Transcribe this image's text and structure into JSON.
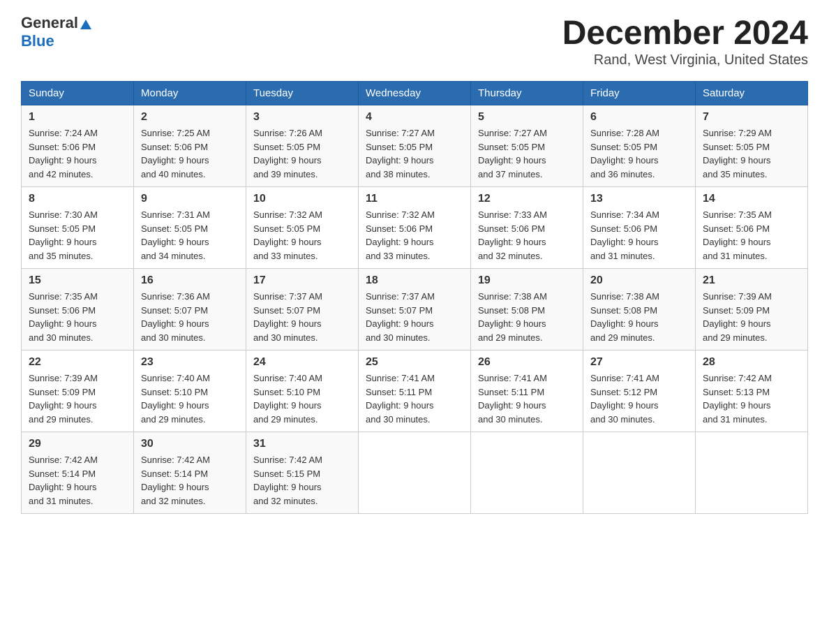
{
  "header": {
    "logo_general": "General",
    "logo_blue": "Blue",
    "month_title": "December 2024",
    "location": "Rand, West Virginia, United States"
  },
  "days_of_week": [
    "Sunday",
    "Monday",
    "Tuesday",
    "Wednesday",
    "Thursday",
    "Friday",
    "Saturday"
  ],
  "weeks": [
    [
      {
        "num": "1",
        "sunrise": "7:24 AM",
        "sunset": "5:06 PM",
        "daylight": "9 hours and 42 minutes."
      },
      {
        "num": "2",
        "sunrise": "7:25 AM",
        "sunset": "5:06 PM",
        "daylight": "9 hours and 40 minutes."
      },
      {
        "num": "3",
        "sunrise": "7:26 AM",
        "sunset": "5:05 PM",
        "daylight": "9 hours and 39 minutes."
      },
      {
        "num": "4",
        "sunrise": "7:27 AM",
        "sunset": "5:05 PM",
        "daylight": "9 hours and 38 minutes."
      },
      {
        "num": "5",
        "sunrise": "7:27 AM",
        "sunset": "5:05 PM",
        "daylight": "9 hours and 37 minutes."
      },
      {
        "num": "6",
        "sunrise": "7:28 AM",
        "sunset": "5:05 PM",
        "daylight": "9 hours and 36 minutes."
      },
      {
        "num": "7",
        "sunrise": "7:29 AM",
        "sunset": "5:05 PM",
        "daylight": "9 hours and 35 minutes."
      }
    ],
    [
      {
        "num": "8",
        "sunrise": "7:30 AM",
        "sunset": "5:05 PM",
        "daylight": "9 hours and 35 minutes."
      },
      {
        "num": "9",
        "sunrise": "7:31 AM",
        "sunset": "5:05 PM",
        "daylight": "9 hours and 34 minutes."
      },
      {
        "num": "10",
        "sunrise": "7:32 AM",
        "sunset": "5:05 PM",
        "daylight": "9 hours and 33 minutes."
      },
      {
        "num": "11",
        "sunrise": "7:32 AM",
        "sunset": "5:06 PM",
        "daylight": "9 hours and 33 minutes."
      },
      {
        "num": "12",
        "sunrise": "7:33 AM",
        "sunset": "5:06 PM",
        "daylight": "9 hours and 32 minutes."
      },
      {
        "num": "13",
        "sunrise": "7:34 AM",
        "sunset": "5:06 PM",
        "daylight": "9 hours and 31 minutes."
      },
      {
        "num": "14",
        "sunrise": "7:35 AM",
        "sunset": "5:06 PM",
        "daylight": "9 hours and 31 minutes."
      }
    ],
    [
      {
        "num": "15",
        "sunrise": "7:35 AM",
        "sunset": "5:06 PM",
        "daylight": "9 hours and 30 minutes."
      },
      {
        "num": "16",
        "sunrise": "7:36 AM",
        "sunset": "5:07 PM",
        "daylight": "9 hours and 30 minutes."
      },
      {
        "num": "17",
        "sunrise": "7:37 AM",
        "sunset": "5:07 PM",
        "daylight": "9 hours and 30 minutes."
      },
      {
        "num": "18",
        "sunrise": "7:37 AM",
        "sunset": "5:07 PM",
        "daylight": "9 hours and 30 minutes."
      },
      {
        "num": "19",
        "sunrise": "7:38 AM",
        "sunset": "5:08 PM",
        "daylight": "9 hours and 29 minutes."
      },
      {
        "num": "20",
        "sunrise": "7:38 AM",
        "sunset": "5:08 PM",
        "daylight": "9 hours and 29 minutes."
      },
      {
        "num": "21",
        "sunrise": "7:39 AM",
        "sunset": "5:09 PM",
        "daylight": "9 hours and 29 minutes."
      }
    ],
    [
      {
        "num": "22",
        "sunrise": "7:39 AM",
        "sunset": "5:09 PM",
        "daylight": "9 hours and 29 minutes."
      },
      {
        "num": "23",
        "sunrise": "7:40 AM",
        "sunset": "5:10 PM",
        "daylight": "9 hours and 29 minutes."
      },
      {
        "num": "24",
        "sunrise": "7:40 AM",
        "sunset": "5:10 PM",
        "daylight": "9 hours and 29 minutes."
      },
      {
        "num": "25",
        "sunrise": "7:41 AM",
        "sunset": "5:11 PM",
        "daylight": "9 hours and 30 minutes."
      },
      {
        "num": "26",
        "sunrise": "7:41 AM",
        "sunset": "5:11 PM",
        "daylight": "9 hours and 30 minutes."
      },
      {
        "num": "27",
        "sunrise": "7:41 AM",
        "sunset": "5:12 PM",
        "daylight": "9 hours and 30 minutes."
      },
      {
        "num": "28",
        "sunrise": "7:42 AM",
        "sunset": "5:13 PM",
        "daylight": "9 hours and 31 minutes."
      }
    ],
    [
      {
        "num": "29",
        "sunrise": "7:42 AM",
        "sunset": "5:14 PM",
        "daylight": "9 hours and 31 minutes."
      },
      {
        "num": "30",
        "sunrise": "7:42 AM",
        "sunset": "5:14 PM",
        "daylight": "9 hours and 32 minutes."
      },
      {
        "num": "31",
        "sunrise": "7:42 AM",
        "sunset": "5:15 PM",
        "daylight": "9 hours and 32 minutes."
      },
      null,
      null,
      null,
      null
    ]
  ],
  "labels": {
    "sunrise_prefix": "Sunrise: ",
    "sunset_prefix": "Sunset: ",
    "daylight_prefix": "Daylight: "
  }
}
